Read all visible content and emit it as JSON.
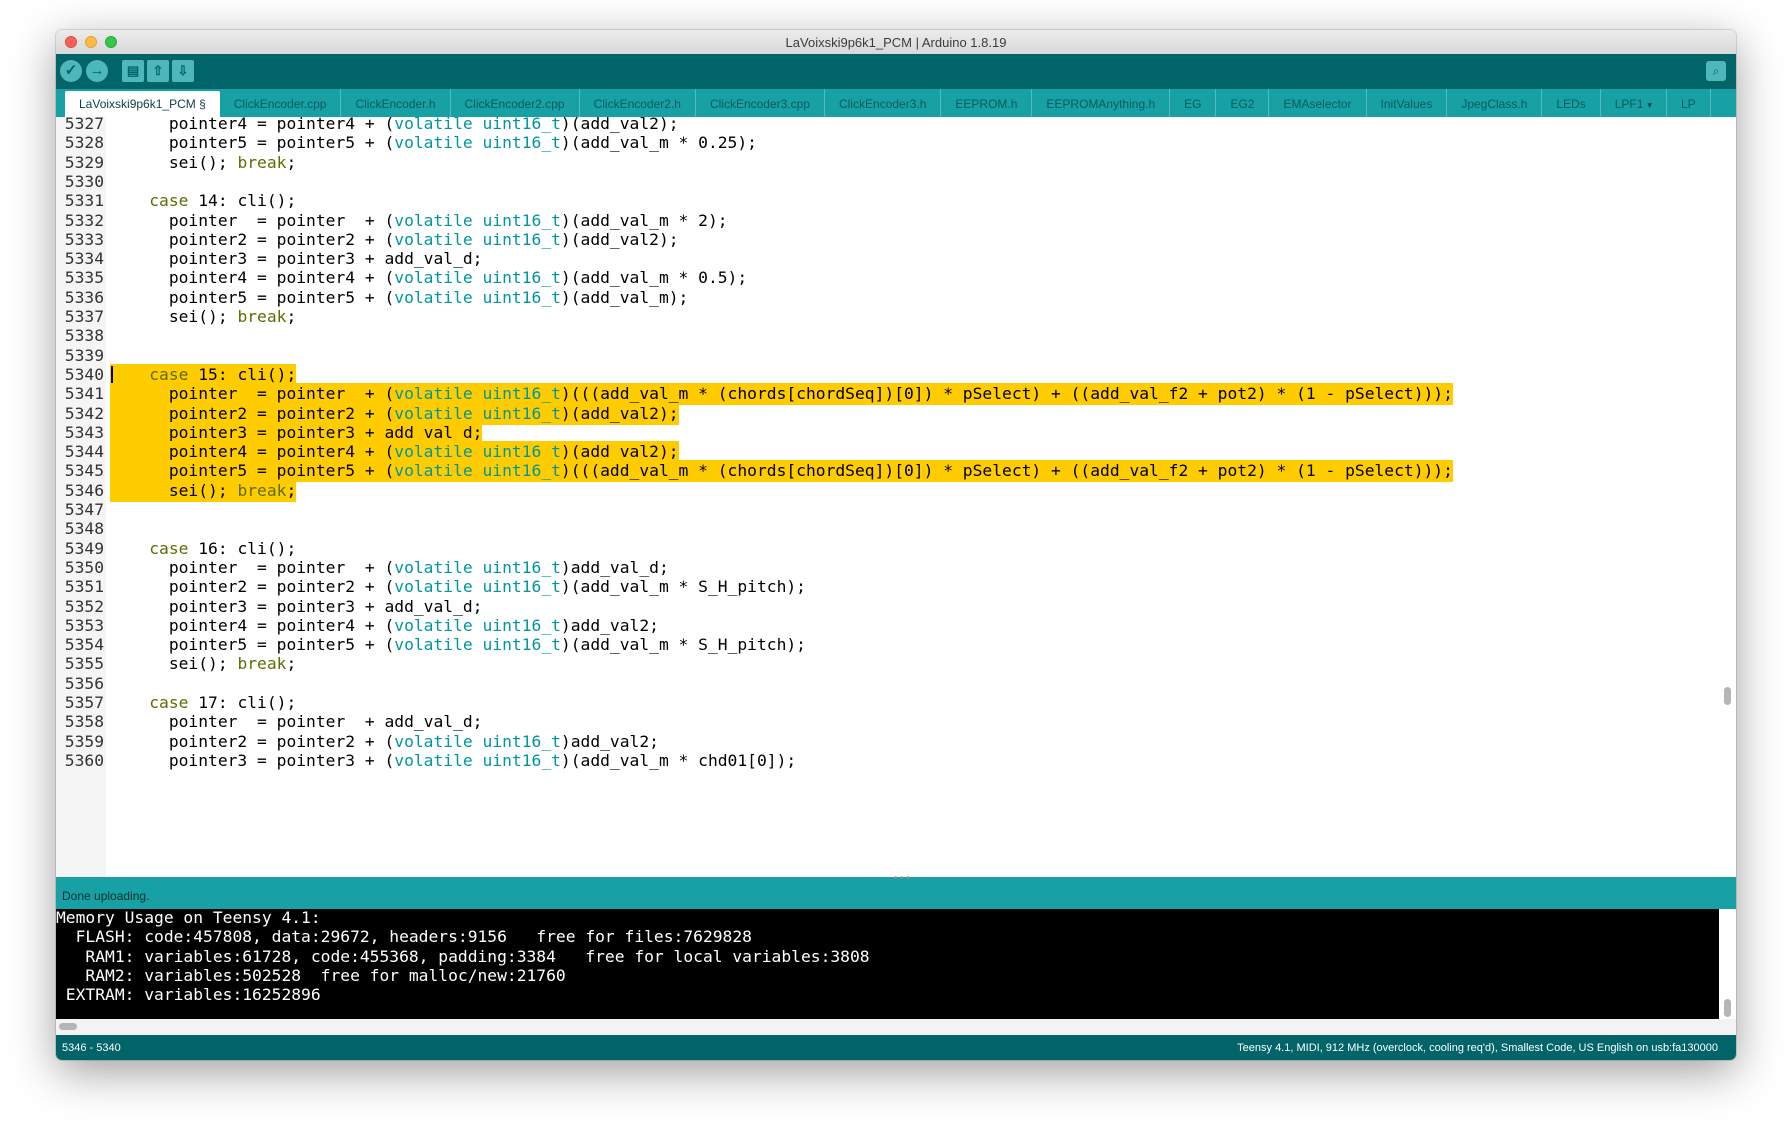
{
  "window": {
    "title": "LaVoixski9p6k1_PCM | Arduino 1.8.19"
  },
  "toolbar": {
    "verify_glyph": "✓",
    "upload_glyph": "→",
    "new_glyph": "▤",
    "open_glyph": "⇧",
    "save_glyph": "⇩",
    "serial_monitor_glyph": "⌕",
    "icons": [
      "verify-icon",
      "upload-icon",
      "new-sketch-icon",
      "open-icon",
      "save-icon",
      "serial-monitor-icon"
    ]
  },
  "tabs": [
    "LaVoixski9p6k1_PCM §",
    "ClickEncoder.cpp",
    "ClickEncoder.h",
    "ClickEncoder2.cpp",
    "ClickEncoder2.h",
    "ClickEncoder3.cpp",
    "ClickEncoder3.h",
    "EEPROM.h",
    "EEPROMAnything.h",
    "EG",
    "EG2",
    "EMAselector",
    "InitValues",
    "JpegClass.h",
    "LEDs",
    "LPF1",
    "LP"
  ],
  "tab_menu_arrow": "▾",
  "editor": {
    "lines": [
      {
        "n": "5327",
        "code": "      pointer4 = pointer4 + (volatile uint16_t)(add_val2);"
      },
      {
        "n": "5328",
        "code": "      pointer5 = pointer5 + (volatile uint16_t)(add_val_m * 0.25);"
      },
      {
        "n": "5329",
        "code": "      sei(); break;"
      },
      {
        "n": "5330",
        "code": ""
      },
      {
        "n": "5331",
        "code": "    case 14: cli();"
      },
      {
        "n": "5332",
        "code": "      pointer  = pointer  + (volatile uint16_t)(add_val_m * 2);"
      },
      {
        "n": "5333",
        "code": "      pointer2 = pointer2 + (volatile uint16_t)(add_val2);"
      },
      {
        "n": "5334",
        "code": "      pointer3 = pointer3 + add_val_d;"
      },
      {
        "n": "5335",
        "code": "      pointer4 = pointer4 + (volatile uint16_t)(add_val_m * 0.5);"
      },
      {
        "n": "5336",
        "code": "      pointer5 = pointer5 + (volatile uint16_t)(add_val_m);"
      },
      {
        "n": "5337",
        "code": "      sei(); break;"
      },
      {
        "n": "5338",
        "code": ""
      },
      {
        "n": "5339",
        "code": ""
      },
      {
        "n": "5340",
        "code": "    case 15: cli();",
        "highlight": true,
        "caret": true
      },
      {
        "n": "5341",
        "code": "      pointer  = pointer  + (volatile uint16_t)(((add_val_m * (chords[chordSeq])[0]) * pSelect) + ((add_val_f2 + pot2) * (1 - pSelect)));",
        "highlight": true
      },
      {
        "n": "5342",
        "code": "      pointer2 = pointer2 + (volatile uint16_t)(add_val2);",
        "highlight": true
      },
      {
        "n": "5343",
        "code": "      pointer3 = pointer3 + add_val_d;",
        "highlight": true
      },
      {
        "n": "5344",
        "code": "      pointer4 = pointer4 + (volatile uint16_t)(add_val2);",
        "highlight": true
      },
      {
        "n": "5345",
        "code": "      pointer5 = pointer5 + (volatile uint16_t)(((add_val_m * (chords[chordSeq])[0]) * pSelect) + ((add_val_f2 + pot2) * (1 - pSelect)));",
        "highlight": true
      },
      {
        "n": "5346",
        "code": "      sei(); break;",
        "highlight": true
      },
      {
        "n": "5347",
        "code": ""
      },
      {
        "n": "5348",
        "code": ""
      },
      {
        "n": "5349",
        "code": "    case 16: cli();"
      },
      {
        "n": "5350",
        "code": "      pointer  = pointer  + (volatile uint16_t)add_val_d;"
      },
      {
        "n": "5351",
        "code": "      pointer2 = pointer2 + (volatile uint16_t)(add_val_m * S_H_pitch);"
      },
      {
        "n": "5352",
        "code": "      pointer3 = pointer3 + add_val_d;"
      },
      {
        "n": "5353",
        "code": "      pointer4 = pointer4 + (volatile uint16_t)add_val2;"
      },
      {
        "n": "5354",
        "code": "      pointer5 = pointer5 + (volatile uint16_t)(add_val_m * S_H_pitch);"
      },
      {
        "n": "5355",
        "code": "      sei(); break;"
      },
      {
        "n": "5356",
        "code": ""
      },
      {
        "n": "5357",
        "code": "    case 17: cli();"
      },
      {
        "n": "5358",
        "code": "      pointer  = pointer  + add_val_d;"
      },
      {
        "n": "5359",
        "code": "      pointer2 = pointer2 + (volatile uint16_t)add_val2;"
      },
      {
        "n": "5360",
        "code": "      pointer3 = pointer3 + (volatile uint16_t)(add_val_m * chd01[0]);"
      }
    ],
    "highlight_color": "#ffcc00",
    "keyword_color": "#5e6d03",
    "type_color": "#00979c"
  },
  "status": {
    "message": "Done uploading.",
    "divider_dots": "• • •"
  },
  "console": {
    "lines": [
      "Memory Usage on Teensy 4.1:",
      "  FLASH: code:457808, data:29672, headers:9156   free for files:7629828",
      "   RAM1: variables:61728, code:455368, padding:3384   free for local variables:3808",
      "   RAM2: variables:502528  free for malloc/new:21760",
      " EXTRAM: variables:16252896"
    ]
  },
  "footer": {
    "line_range": "5346 - 5340",
    "board_info": "Teensy 4.1, MIDI, 912 MHz (overclock, cooling req'd), Smallest Code, US English on usb:fa130000"
  },
  "colors": {
    "teal_dark": "#006468",
    "teal_tabs": "#17a1a5",
    "button_fill": "#4db7bb"
  }
}
